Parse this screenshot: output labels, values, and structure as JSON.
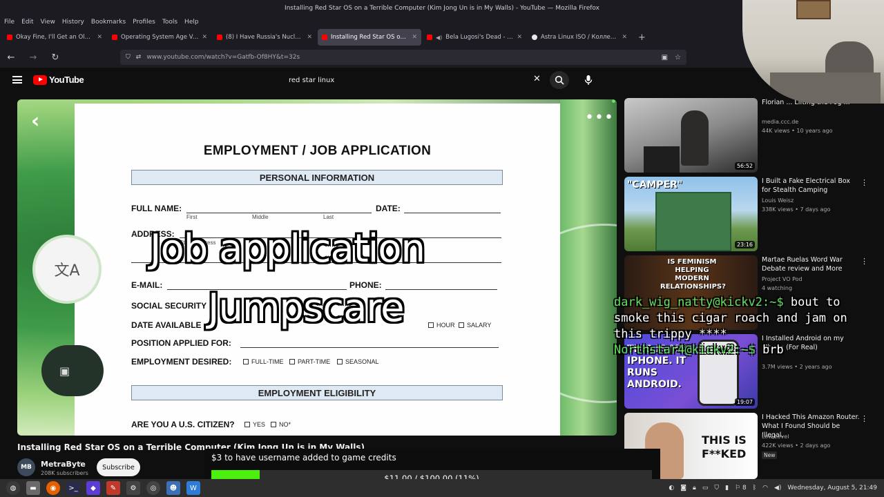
{
  "window": {
    "title": "Installing Red Star OS on a Terrible Computer (Kim Jong Un is in My Walls) - YouTube — Mozilla Firefox"
  },
  "menu": [
    "File",
    "Edit",
    "View",
    "History",
    "Bookmarks",
    "Profiles",
    "Tools",
    "Help"
  ],
  "tabs": [
    {
      "title": "Okay Fine, I'll Get an Old Th",
      "active": false,
      "icon": "youtube-icon"
    },
    {
      "title": "Operating System Age Verif",
      "active": false,
      "icon": "youtube-icon"
    },
    {
      "title": "(8) I Have Russia's Nuclear C",
      "active": false,
      "icon": "youtube-icon"
    },
    {
      "title": "Installing Red Star OS on a T",
      "active": true,
      "icon": "youtube-icon"
    },
    {
      "title": "Bela Lugosi's Dead - Bau",
      "active": false,
      "icon": "youtube-icon"
    },
    {
      "title": "Astra Linux ISO / Коллекция",
      "active": false,
      "icon": "github-icon"
    }
  ],
  "nav": {
    "url": "www.youtube.com/watch?v=Gatfb-Of8HY&t=32s"
  },
  "youtube": {
    "logo_text": "YouTube",
    "search_value": "red star linux"
  },
  "video": {
    "overlay_line1": "Job application",
    "overlay_line2": "Jumpscare",
    "title": "Installing Red Star OS on a Terrible Computer (Kim Jong Un is in My Walls)",
    "channel": "MetraByte",
    "channel_initials": "MB",
    "subscribers": "208K subscribers",
    "subscribe_label": "Subscribe",
    "document": {
      "title": "EMPLOYMENT / JOB APPLICATION",
      "section1": "PERSONAL INFORMATION",
      "section2": "EMPLOYMENT ELIGIBILITY",
      "full_name": "FULL NAME:",
      "date": "DATE:",
      "first": "First",
      "middle": "Middle",
      "last": "Last",
      "address": "ADDRESS:",
      "street": "Street Address",
      "email": "E-MAIL:",
      "phone": "PHONE:",
      "ssn": "SOCIAL SECURITY",
      "date_available": "DATE AVAILABLE",
      "hour": "HOUR",
      "salary": "SALARY",
      "position": "POSITION APPLIED FOR:",
      "employment_desired": "EMPLOYMENT DESIRED:",
      "full_time": "FULL-TIME",
      "part_time": "PART-TIME",
      "seasonal": "SEASONAL",
      "citizen": "ARE YOU A U.S. CITIZEN?",
      "yes": "YES",
      "no": "NO*"
    }
  },
  "recommendations": [
    {
      "title": "Florian ... Lifting the Fog ...",
      "channel": "media.ccc.de",
      "meta": "44K views • 10 years ago",
      "duration": "56:52"
    },
    {
      "title": "I Built a Fake Electrical Box for Stealth Camping",
      "channel": "Louis Weisz",
      "meta": "338K views • 7 days ago",
      "duration": "23:16",
      "thumb_text": "\"CAMPER\""
    },
    {
      "title": "Martae Ruelas Word War Debate review and More",
      "channel": "Project VO Pod",
      "meta": "4 watching",
      "duration": "",
      "thumb_text": "IS FEMINISM HELPING MODERN RELATIONSHIPS?"
    },
    {
      "title": "I Installed Android on my iPhone (For Real)",
      "channel": "",
      "meta": "3.7M views • 2 years ago",
      "duration": "19:07",
      "thumb_text": "THIS IS MY IPHONE. IT RUNS ANDROID."
    },
    {
      "title": "I Hacked This Amazon Router. What I Found Should be Illegal.",
      "channel": "Low Level",
      "meta": "422K views • 2 days ago",
      "duration": "",
      "badge": "New",
      "thumb_text": "THIS IS F**KED"
    }
  ],
  "chat_overlay": {
    "prompt1": "dark_wig_natty@kickv2:~$",
    "message1": "bout to smoke this cigar roach and jam on this trippy ****",
    "prompt2": "Northstar4@kickv2:~$",
    "message2": "brb"
  },
  "credits": {
    "label": "$3 to have username added to game credits",
    "progress_text": "$11.00 / $100.00 (11%)",
    "progress_fraction": 0.11,
    "fill_color": "#4cf00f"
  },
  "taskbar": {
    "clock": "Wednesday, August  5, 21:49",
    "badge": "8"
  },
  "colors": {
    "youtube_red": "#ff0000",
    "firefox_bg": "#1c1b22",
    "active_tab": "#42414d",
    "terminal_prompt": "#60e060"
  }
}
